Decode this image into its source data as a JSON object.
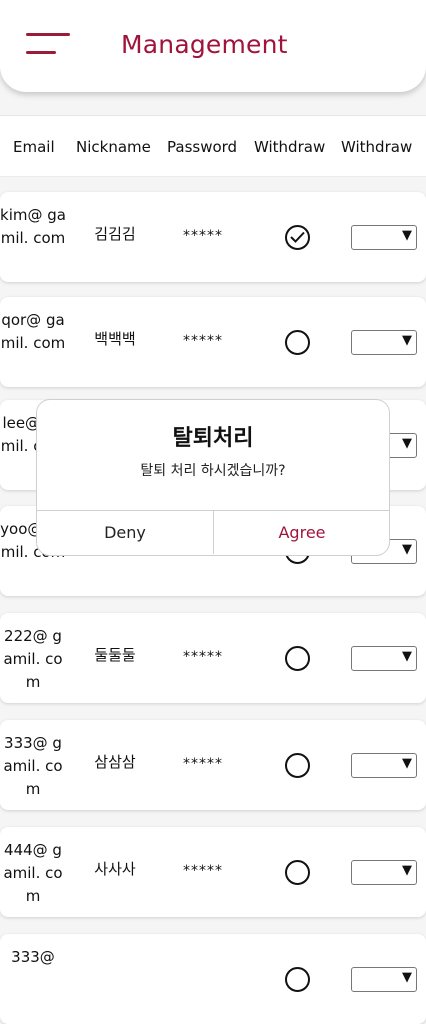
{
  "header": {
    "title": "Management",
    "menu_icon": "hamburger-menu-icon"
  },
  "table": {
    "columns": [
      "Email",
      "Nickname",
      "Password",
      "Withdraw",
      "Withdraw"
    ],
    "rows": [
      {
        "email": "kim@ gamil. com",
        "nickname": "김김김",
        "password": "*****",
        "checked": true
      },
      {
        "email": "qor@ gamil. com",
        "nickname": "백백백",
        "password": "*****",
        "checked": false
      },
      {
        "email": "lee@ gamil. com",
        "nickname": "",
        "password": "",
        "checked": false
      },
      {
        "email": "yoo@ gamil. com",
        "nickname": "",
        "password": "",
        "checked": false
      },
      {
        "email": "222@ gamil. com",
        "nickname": "둘둘둘",
        "password": "*****",
        "checked": false
      },
      {
        "email": "333@ gamil. com",
        "nickname": "삼삼삼",
        "password": "*****",
        "checked": false
      },
      {
        "email": "444@ gamil. com",
        "nickname": "사사사",
        "password": "*****",
        "checked": false
      },
      {
        "email": "333@",
        "nickname": "",
        "password": "",
        "checked": false
      }
    ],
    "select_caret": "▼"
  },
  "dialog": {
    "title": "탈퇴처리",
    "message": "탈퇴 처리 하시겠습니까?",
    "deny_label": "Deny",
    "agree_label": "Agree"
  },
  "colors": {
    "accent": "#a0143c",
    "background": "#f5f5f5"
  }
}
